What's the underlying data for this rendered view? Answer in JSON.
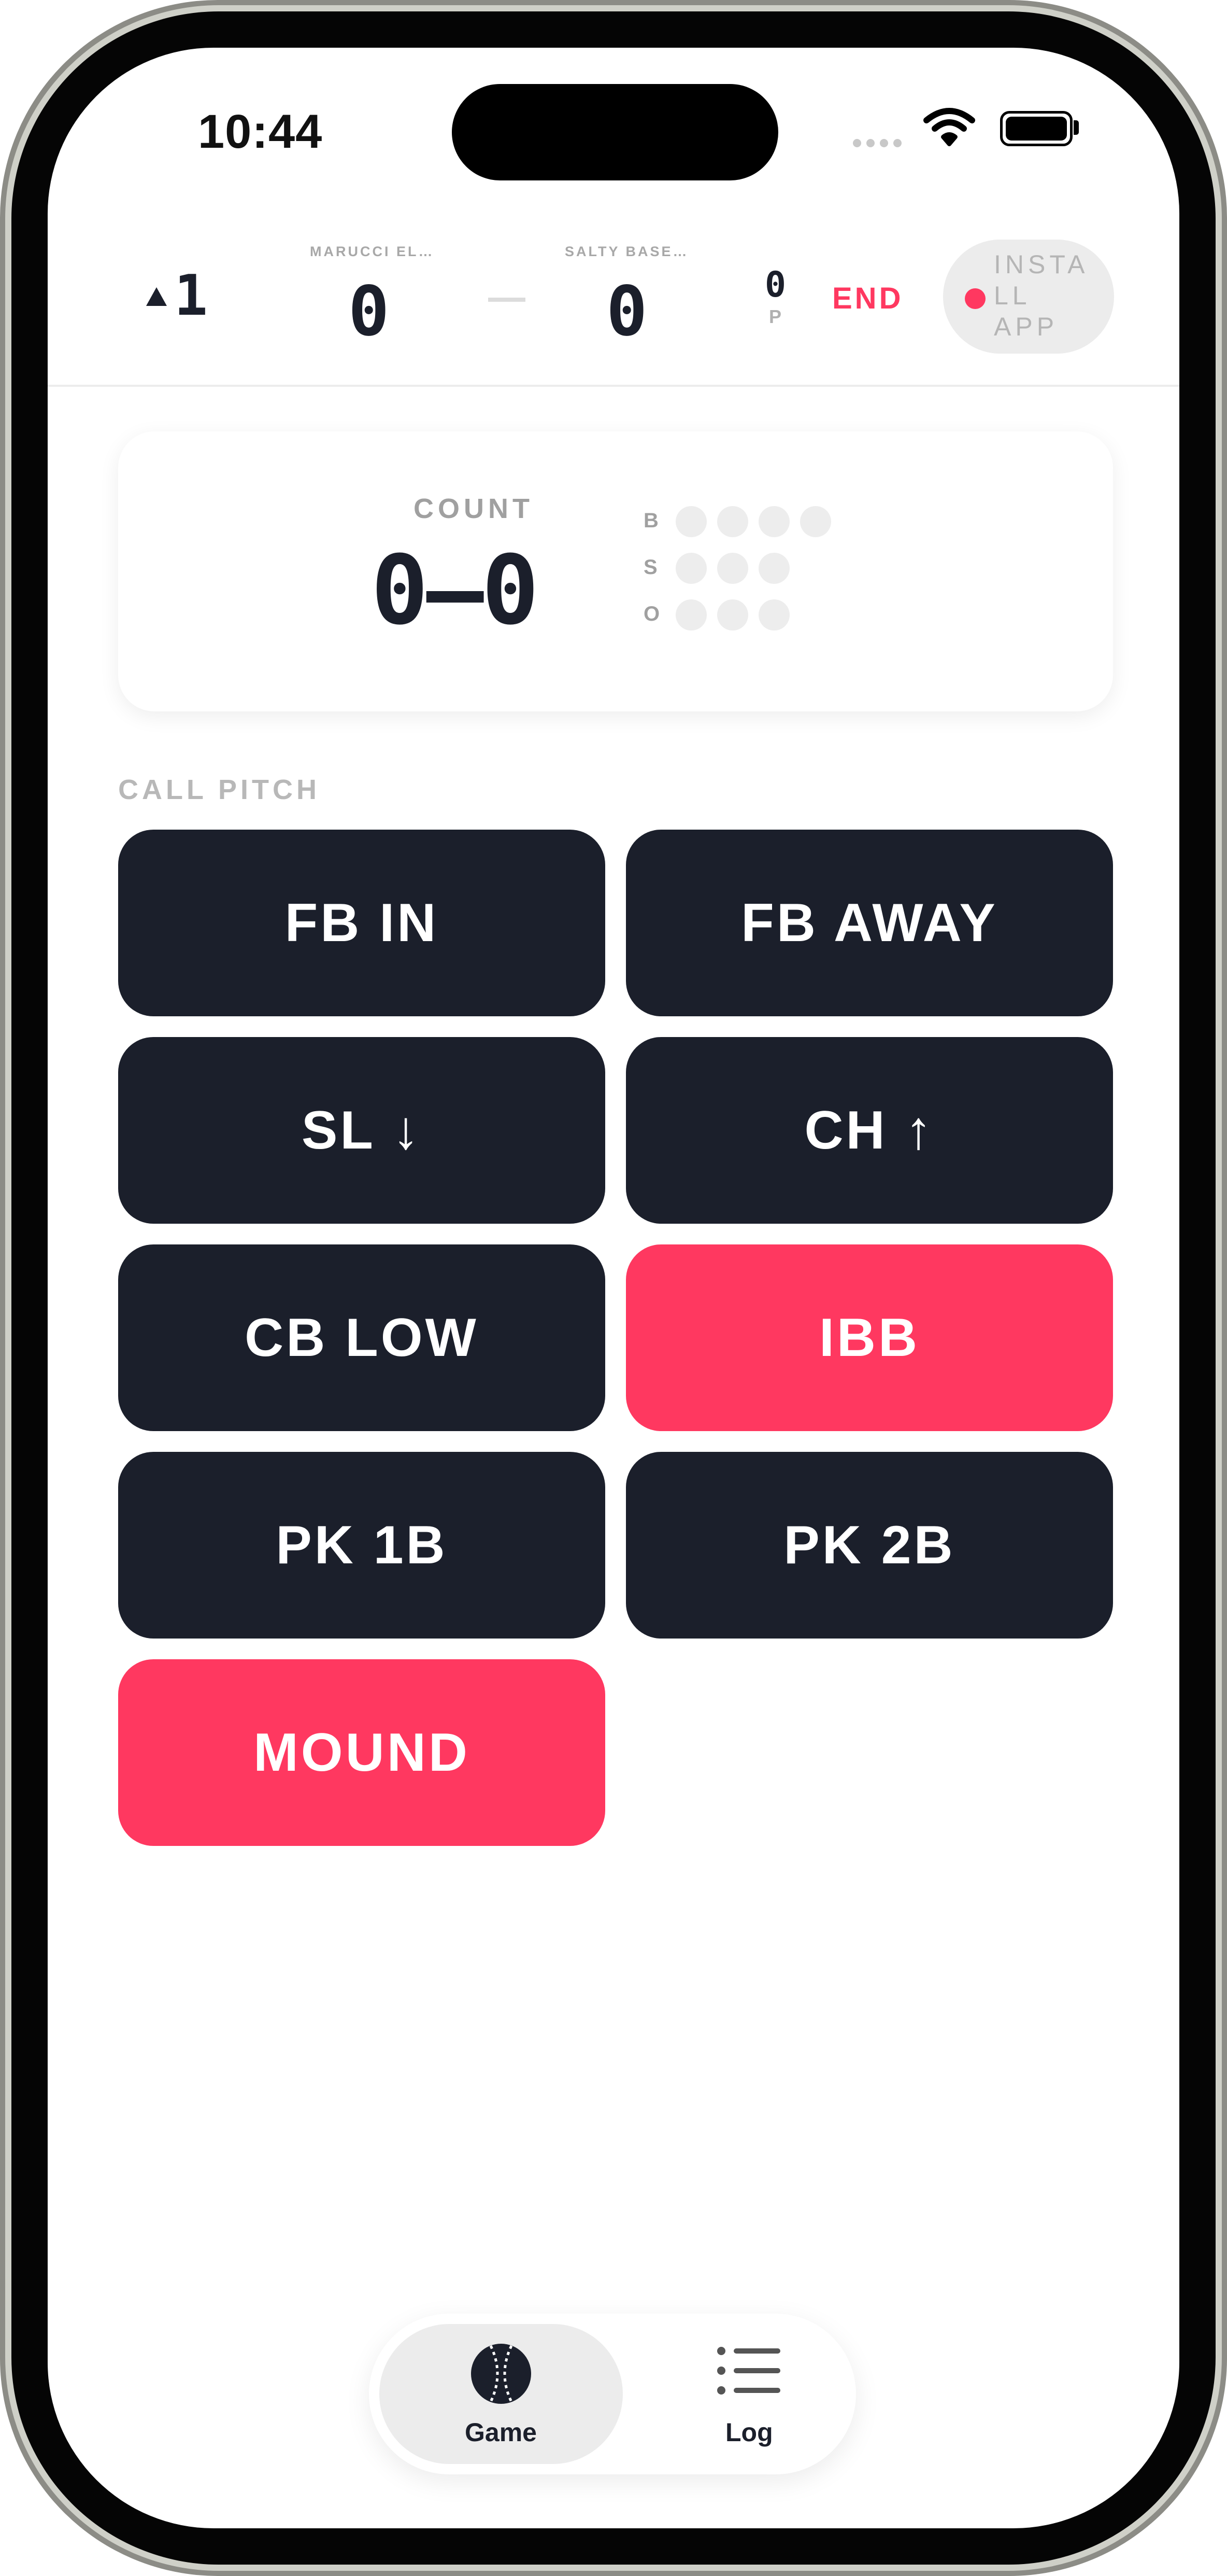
{
  "status_bar": {
    "time": "10:44"
  },
  "header": {
    "inning": "1",
    "away_team": "MARUCCI EL…",
    "home_team": "SALTY BASE…",
    "away_score": "0",
    "separator": "—",
    "home_score": "0",
    "pitch_count": "0",
    "pitch_label": "P",
    "end_label": "END",
    "install_label_lines": [
      "INSTA",
      "LL",
      "APP"
    ]
  },
  "count_card": {
    "label": "COUNT",
    "value": "0–0",
    "balls_label": "B",
    "strikes_label": "S",
    "outs_label": "O"
  },
  "call_pitch": {
    "heading": "CALL PITCH",
    "buttons": [
      {
        "label": "FB IN",
        "color": "#1b1f2b"
      },
      {
        "label": "FB AWAY",
        "color": "#1b1f2b"
      },
      {
        "label": "SL ↓",
        "color": "#1b1f2b"
      },
      {
        "label": "CH ↑",
        "color": "#1b1f2b"
      },
      {
        "label": "CB LOW",
        "color": "#1b1f2b"
      },
      {
        "label": "IBB",
        "color": "#ff3860"
      },
      {
        "label": "PK 1B",
        "color": "#1b1f2b"
      },
      {
        "label": "PK 2B",
        "color": "#1b1f2b"
      },
      {
        "label": "MOUND",
        "color": "#ff3860"
      }
    ]
  },
  "tab_bar": {
    "tabs": [
      {
        "label": "Game",
        "icon": "baseball-icon",
        "active": true
      },
      {
        "label": "Log",
        "icon": "list-icon",
        "active": false
      }
    ]
  },
  "colors": {
    "accent": "#ff3860",
    "dark": "#1b1f2b"
  }
}
